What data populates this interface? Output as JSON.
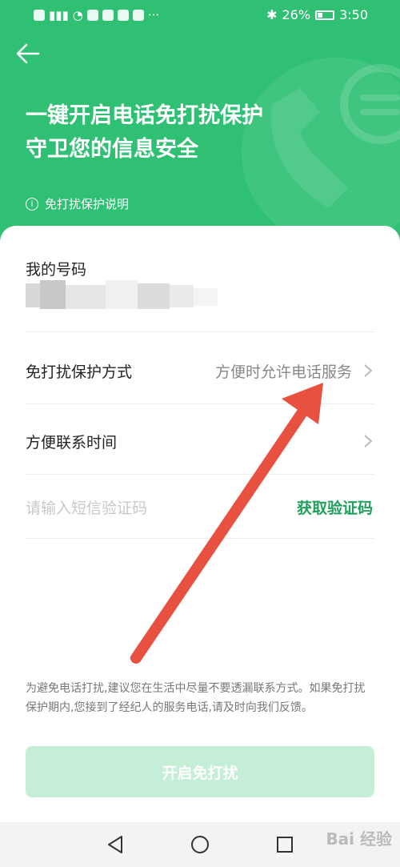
{
  "status_bar": {
    "battery": "26%",
    "time": "3:50"
  },
  "header": {
    "title_line1": "一键开启电话免打扰保护",
    "title_line2": "守卫您的信息安全",
    "note": "免打扰保护说明"
  },
  "form": {
    "my_number_label": "我的号码",
    "mode_label": "免打扰保护方式",
    "mode_value": "方便时允许电话服务",
    "time_label": "方便联系时间",
    "code_placeholder": "请输入短信验证码",
    "get_code": "获取验证码"
  },
  "tip": "为避免电话打扰,建议您在生活中尽量不要透漏联系方式。如果免打扰保护期内,您接到了经纪人的服务电话,请及时向我们反馈。",
  "open_button": "开启免打扰",
  "watermark": "Bai 经验",
  "colors": {
    "brand_green": "#2fc073",
    "link_green": "#20a05c",
    "annotation_red": "#e8503f"
  }
}
